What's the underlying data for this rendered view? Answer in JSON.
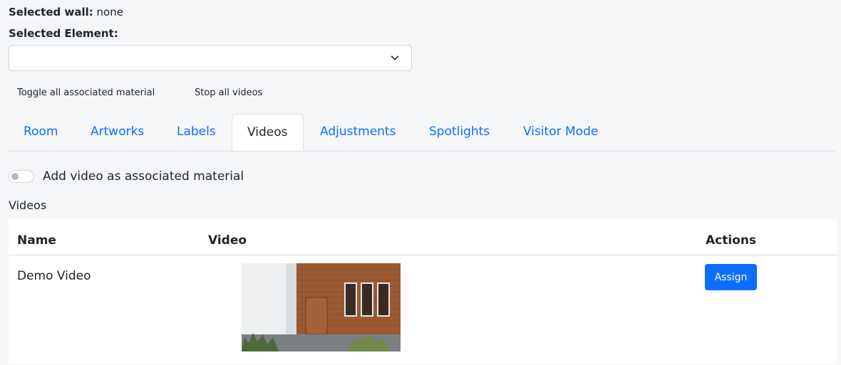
{
  "header": {
    "selected_wall_label": "Selected wall:",
    "selected_wall_value": "none",
    "selected_element_label": "Selected Element:"
  },
  "element_select": {
    "value": ""
  },
  "actions": {
    "toggle_all": "Toggle all associated material",
    "stop_all": "Stop all videos"
  },
  "tabs": [
    {
      "label": "Room",
      "active": false
    },
    {
      "label": "Artworks",
      "active": false
    },
    {
      "label": "Labels",
      "active": false
    },
    {
      "label": "Videos",
      "active": true
    },
    {
      "label": "Adjustments",
      "active": false
    },
    {
      "label": "Spotlights",
      "active": false
    },
    {
      "label": "Visitor Mode",
      "active": false
    }
  ],
  "switch": {
    "label": "Add video as associated material",
    "checked": false
  },
  "section_title": "Videos",
  "table": {
    "columns": [
      "Name",
      "Video",
      "Actions"
    ],
    "rows": [
      {
        "name": "Demo Video",
        "thumbnail_icon": "video-thumbnail-house-icon",
        "action_label": "Assign"
      }
    ]
  },
  "colors": {
    "accent": "#0d6efd",
    "background": "#f5f6f8",
    "text": "#212529"
  }
}
